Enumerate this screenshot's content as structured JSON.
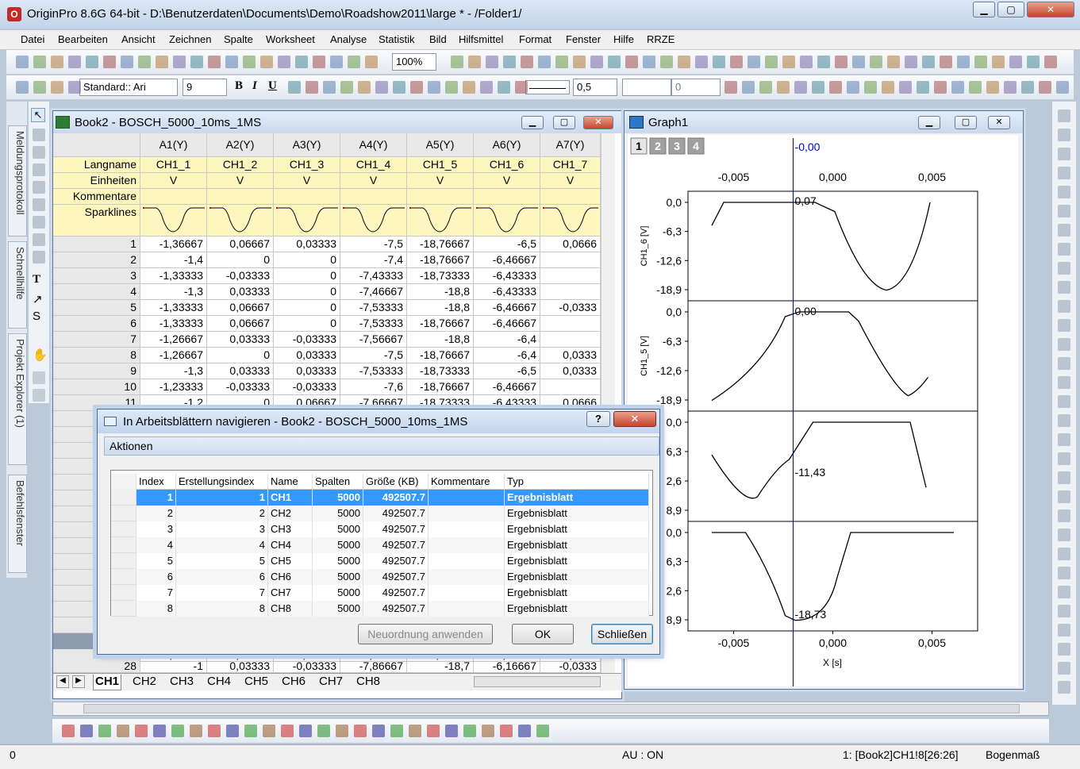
{
  "app": {
    "title": "OriginPro 8.6G 64-bit - D:\\Benutzerdaten\\Documents\\Demo\\Roadshow2011\\large * - /Folder1/",
    "icon_label": "O"
  },
  "menu": [
    "Datei",
    "Bearbeiten",
    "Ansicht",
    "Zeichnen",
    "Spalte",
    "Worksheet",
    "Analyse",
    "Statistik",
    "Bild",
    "Hilfsmittel",
    "Format",
    "Fenster",
    "Hilfe",
    "RRZE"
  ],
  "toolbar": {
    "zoom": "100%",
    "style": "Standard:: Ari",
    "font_size": "9",
    "line_width": "0,5",
    "fill_value": "0"
  },
  "left_dock_tabs": [
    "Meldungsprotokoll",
    "Schnellhilfe",
    "Projekt Explorer (1)",
    "Befehlsfenster"
  ],
  "workbook": {
    "title": "Book2 - BOSCH_5000_10ms_1MS",
    "columns": [
      "A1(Y)",
      "A2(Y)",
      "A3(Y)",
      "A4(Y)",
      "A5(Y)",
      "A6(Y)",
      "A7(Y)"
    ],
    "meta_labels": [
      "Langname",
      "Einheiten",
      "Kommentare",
      "Sparklines"
    ],
    "longnames": [
      "CH1_1",
      "CH1_2",
      "CH1_3",
      "CH1_4",
      "CH1_5",
      "CH1_6",
      "CH1_7"
    ],
    "units": [
      "V",
      "V",
      "V",
      "V",
      "V",
      "V",
      "V"
    ],
    "rows": [
      [
        "1",
        "-1,36667",
        "0,06667",
        "0,03333",
        "-7,5",
        "-18,76667",
        "-6,5",
        "0,0666"
      ],
      [
        "2",
        "-1,4",
        "0",
        "0",
        "-7,4",
        "-18,76667",
        "-6,46667",
        ""
      ],
      [
        "3",
        "-1,33333",
        "-0,03333",
        "0",
        "-7,43333",
        "-18,73333",
        "-6,43333",
        ""
      ],
      [
        "4",
        "-1,3",
        "0,03333",
        "0",
        "-7,46667",
        "-18,8",
        "-6,43333",
        ""
      ],
      [
        "5",
        "-1,33333",
        "0,06667",
        "0",
        "-7,53333",
        "-18,8",
        "-6,46667",
        "-0,0333"
      ],
      [
        "6",
        "-1,33333",
        "0,06667",
        "0",
        "-7,53333",
        "-18,76667",
        "-6,46667",
        ""
      ],
      [
        "7",
        "-1,26667",
        "0,03333",
        "-0,03333",
        "-7,56667",
        "-18,8",
        "-6,4",
        ""
      ],
      [
        "8",
        "-1,26667",
        "0",
        "0,03333",
        "-7,5",
        "-18,76667",
        "-6,4",
        "0,0333"
      ],
      [
        "9",
        "-1,3",
        "0,03333",
        "0,03333",
        "-7,53333",
        "-18,73333",
        "-6,5",
        "0,0333"
      ],
      [
        "10",
        "-1,23333",
        "-0,03333",
        "-0,03333",
        "-7,6",
        "-18,76667",
        "-6,46667",
        ""
      ],
      [
        "11",
        "-1,2",
        "0",
        "0,06667",
        "-7,66667",
        "-18,73333",
        "-6,43333",
        "0,0666"
      ]
    ],
    "partial_rows": [
      [
        "27",
        "-1,06667",
        "0,03333",
        "-0,06667",
        "-7,86667",
        "-18,73333",
        "-6,26667",
        "-0,0333"
      ],
      [
        "28",
        "-1",
        "0,03333",
        "-0,03333",
        "-7,86667",
        "-18,7",
        "-6,16667",
        "-0,0333"
      ]
    ],
    "sheets": [
      "CH1",
      "CH2",
      "CH3",
      "CH4",
      "CH5",
      "CH6",
      "CH7",
      "CH8"
    ]
  },
  "graph": {
    "title": "Graph1",
    "layers": [
      "1",
      "2",
      "3",
      "4"
    ],
    "cursor_label": "-0,00",
    "x_ticks": [
      "-0,005",
      "0,000",
      "0,005"
    ],
    "y_ticks": [
      "0,0",
      "-6,3",
      "-12,6",
      "-18,9"
    ],
    "y_ticks_partial": [
      "0,0",
      "6,3",
      "2,6",
      "8,9"
    ],
    "panel_ylabels": [
      "CH1_6 [V]",
      "CH1_5 [V]"
    ],
    "readouts": [
      "0,07",
      "0,00",
      "-11,43",
      "-18,73"
    ],
    "xlabel": "X [s]"
  },
  "dialog": {
    "title": "In Arbeitsblättern navigieren - Book2 - BOSCH_5000_10ms_1MS",
    "help": "?",
    "section": "Aktionen",
    "columns": [
      "Index",
      "Erstellungsindex",
      "Name",
      "Spalten",
      "Größe (KB)",
      "Kommentare",
      "Typ"
    ],
    "rows": [
      [
        "1",
        "1",
        "CH1",
        "5000",
        "492507.7",
        "",
        "Ergebnisblatt"
      ],
      [
        "2",
        "2",
        "CH2",
        "5000",
        "492507.7",
        "",
        "Ergebnisblatt"
      ],
      [
        "3",
        "3",
        "CH3",
        "5000",
        "492507.7",
        "",
        "Ergebnisblatt"
      ],
      [
        "4",
        "4",
        "CH4",
        "5000",
        "492507.7",
        "",
        "Ergebnisblatt"
      ],
      [
        "5",
        "5",
        "CH5",
        "5000",
        "492507.7",
        "",
        "Ergebnisblatt"
      ],
      [
        "6",
        "6",
        "CH6",
        "5000",
        "492507.7",
        "",
        "Ergebnisblatt"
      ],
      [
        "7",
        "7",
        "CH7",
        "5000",
        "492507.7",
        "",
        "Ergebnisblatt"
      ],
      [
        "8",
        "8",
        "CH8",
        "5000",
        "492507.7",
        "",
        "Ergebnisblatt"
      ]
    ],
    "buttons": {
      "apply": "Neuordnung anwenden",
      "ok": "OK",
      "close": "Schließen"
    }
  },
  "status": {
    "left": "0",
    "au": "AU : ON",
    "cell": "1: [Book2]CH1!8[26:26]",
    "angle": "Bogenmaß"
  },
  "colors": {
    "selection": "#3399ff",
    "cursor_line": "#0000cc",
    "meta_yellow": "#fdf6bf"
  }
}
